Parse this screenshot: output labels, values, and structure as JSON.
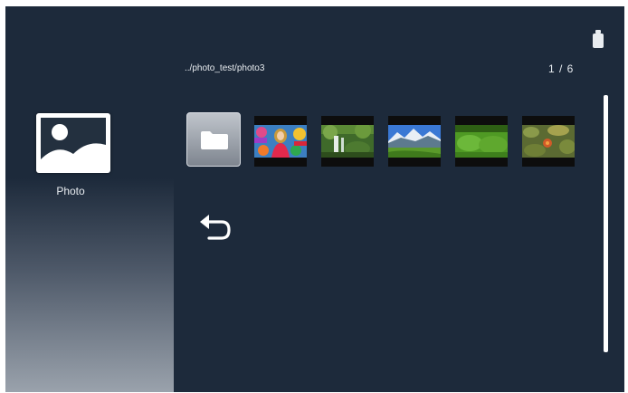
{
  "category": {
    "label": "Photo",
    "icon": "photo-icon"
  },
  "header": {
    "path": "../photo_test/photo3",
    "page_counter": "1 / 6",
    "storage_icon": "usb-drive-icon"
  },
  "items": [
    {
      "type": "folder",
      "icon": "folder-icon"
    },
    {
      "type": "photo",
      "subject": "person-colorful"
    },
    {
      "type": "photo",
      "subject": "waterfall-forest"
    },
    {
      "type": "photo",
      "subject": "mountain-landscape"
    },
    {
      "type": "photo",
      "subject": "green-moss"
    },
    {
      "type": "photo",
      "subject": "leaves-flower"
    }
  ],
  "back": {
    "icon": "return-arrow-icon"
  },
  "colors": {
    "background": "#1d2a3b",
    "text": "#e8ecf0"
  }
}
